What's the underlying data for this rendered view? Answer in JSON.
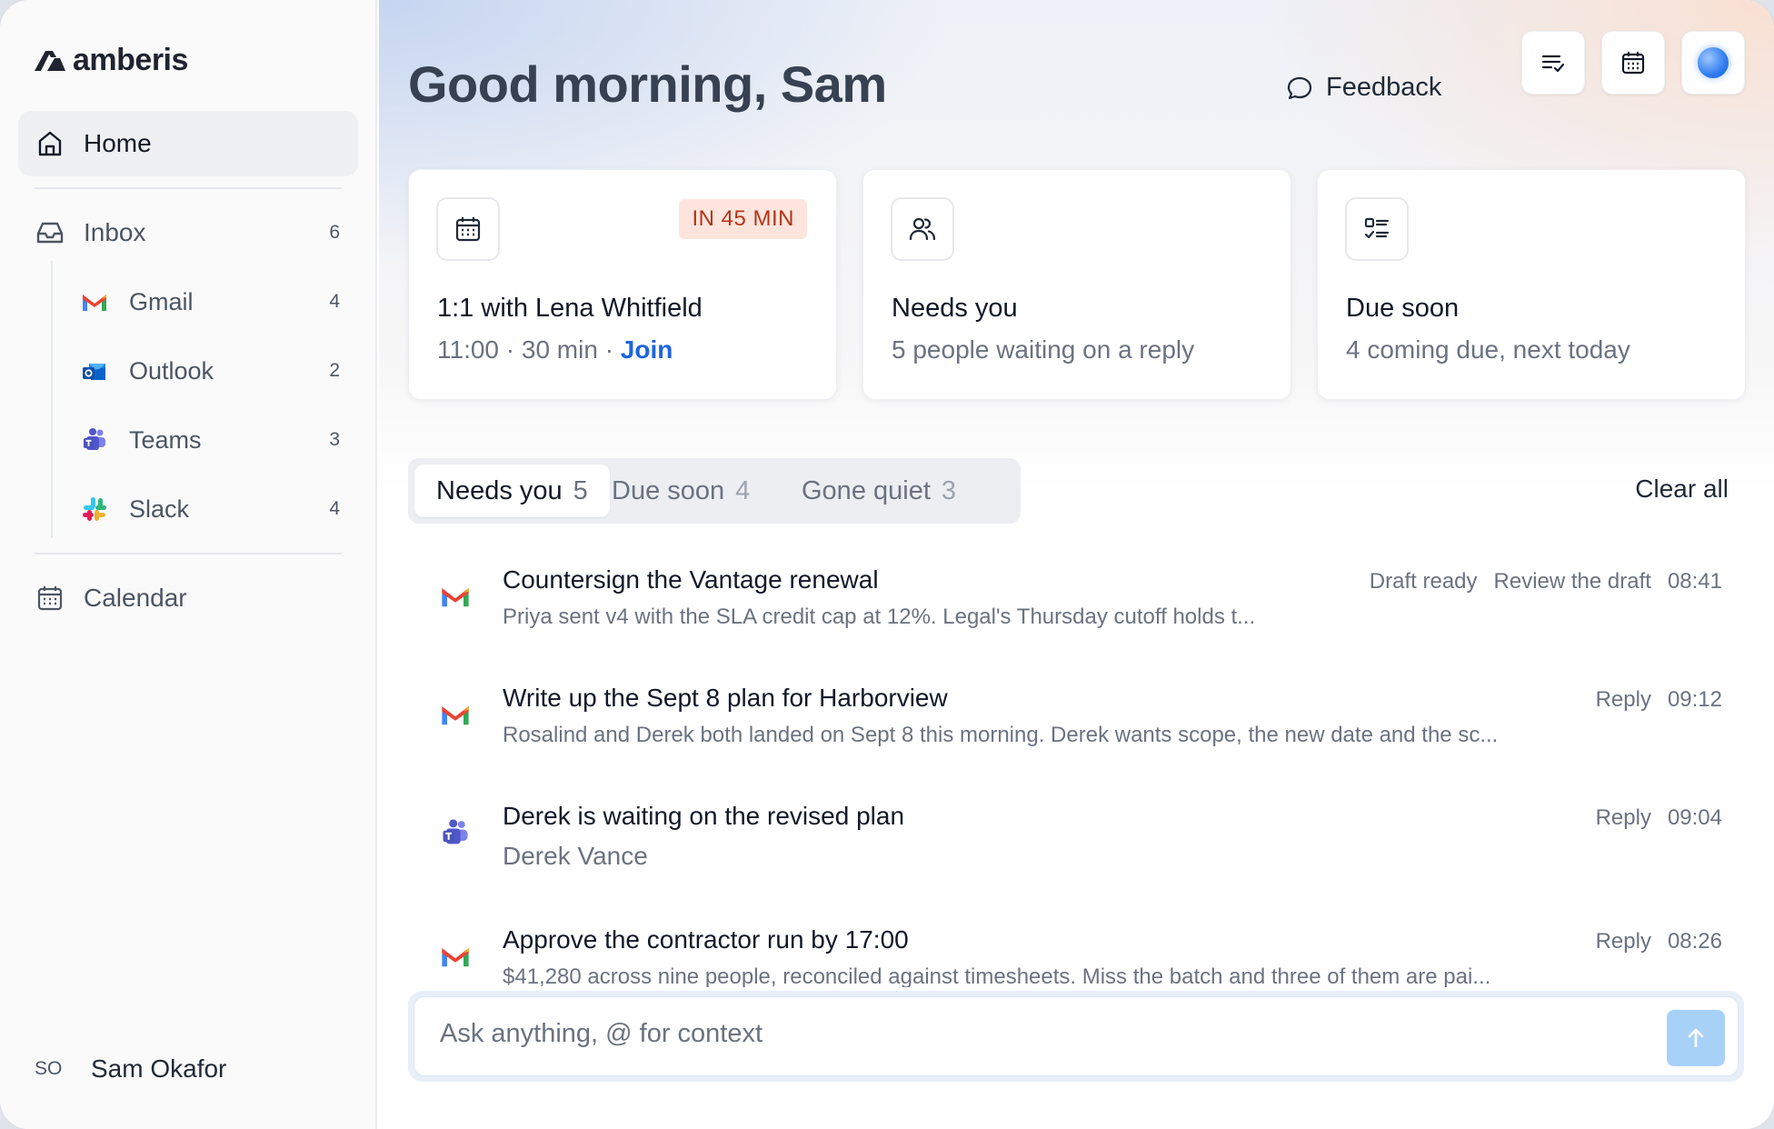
{
  "app": {
    "brand": "amberis"
  },
  "sidebar": {
    "home": {
      "label": "Home",
      "icon": "home-icon"
    },
    "inbox": {
      "label": "Inbox",
      "count": "6",
      "icon": "inbox-icon"
    },
    "sources": [
      {
        "label": "Gmail",
        "count": "4",
        "icon": "gmail-icon"
      },
      {
        "label": "Outlook",
        "count": "2",
        "icon": "outlook-icon"
      },
      {
        "label": "Teams",
        "count": "3",
        "icon": "teams-icon"
      },
      {
        "label": "Slack",
        "count": "4",
        "icon": "slack-icon"
      }
    ],
    "calendar": {
      "label": "Calendar",
      "icon": "calendar-icon"
    },
    "user": {
      "initials": "SO",
      "name": "Sam Okafor"
    }
  },
  "header": {
    "greeting": "Good morning, Sam",
    "feedback_label": "Feedback"
  },
  "cards": [
    {
      "icon": "calendar-icon",
      "badge": "IN 45 MIN",
      "title": "1:1 with Lena Whitfield",
      "subtitle": "11:00 · 30 min · ",
      "link": "Join"
    },
    {
      "icon": "people-icon",
      "title": "Needs you",
      "subtitle": "5 people waiting on a reply"
    },
    {
      "icon": "checklist-icon",
      "title": "Due soon",
      "subtitle": "4 coming due, next today"
    }
  ],
  "tabs": [
    {
      "label": "Needs you",
      "count": "5",
      "active": true
    },
    {
      "label": "Due soon",
      "count": "4"
    },
    {
      "label": "Gone quiet",
      "count": "3"
    }
  ],
  "clear_all": "Clear all",
  "items": [
    {
      "source": "gmail-icon",
      "title": "Countersign the Vantage renewal",
      "preview": "Priya sent v4 with the SLA credit cap at 12%. Legal's Thursday cutoff holds t...",
      "status": "Draft ready",
      "action": "Review the draft",
      "time": "08:41"
    },
    {
      "source": "gmail-icon",
      "title": "Write up the Sept 8 plan for Harborview",
      "preview": "Rosalind and Derek both landed on Sept 8 this morning. Derek wants scope, the new date and the sc...",
      "action": "Reply",
      "time": "09:12"
    },
    {
      "source": "teams-icon",
      "title": "Derek is waiting on the revised plan",
      "preview": "Derek Vance",
      "action": "Reply",
      "time": "09:04"
    },
    {
      "source": "gmail-icon",
      "title": "Approve the contractor run by 17:00",
      "preview": "$41,280 across nine people, reconciled against timesheets. Miss the batch and three of them are pai...",
      "action": "Reply",
      "time": "08:26"
    }
  ],
  "composer": {
    "placeholder": "Ask anything, @ for context"
  },
  "colors": {
    "accent": "#1d64e0",
    "badge_bg": "#fde5de",
    "badge_fg": "#b43416",
    "send_bg": "#a8d1f8"
  }
}
